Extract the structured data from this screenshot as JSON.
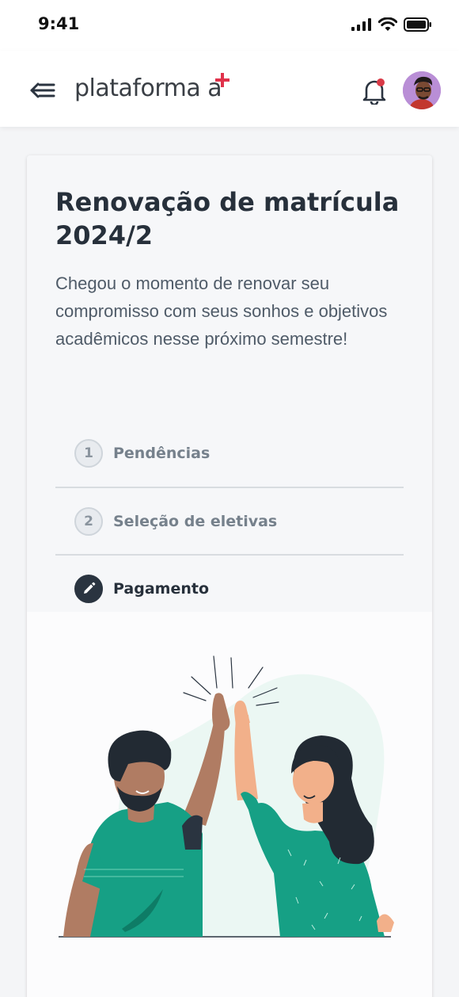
{
  "status_bar": {
    "time": "9:41"
  },
  "header": {
    "brand": "plataforma a"
  },
  "card": {
    "title": "Renovação de matrícula 2024/2",
    "description": "Chegou o momento de renovar seu compromisso com seus sonhos e objetivos acadêmicos nesse próximo semestre!",
    "steps": [
      {
        "number": "1",
        "label": "Pendências",
        "state": "pending"
      },
      {
        "number": "2",
        "label": "Seleção de eletivas",
        "state": "pending"
      },
      {
        "number": "",
        "label": "Pagamento",
        "state": "current"
      }
    ]
  },
  "colors": {
    "brand_plus": "#e0324b",
    "accent_green": "#16a085",
    "dark": "#2a3440",
    "notification_dot": "#d93a47"
  },
  "icons": {
    "back": "back-arrow-icon",
    "bell": "bell-icon",
    "pencil": "pencil-icon"
  }
}
